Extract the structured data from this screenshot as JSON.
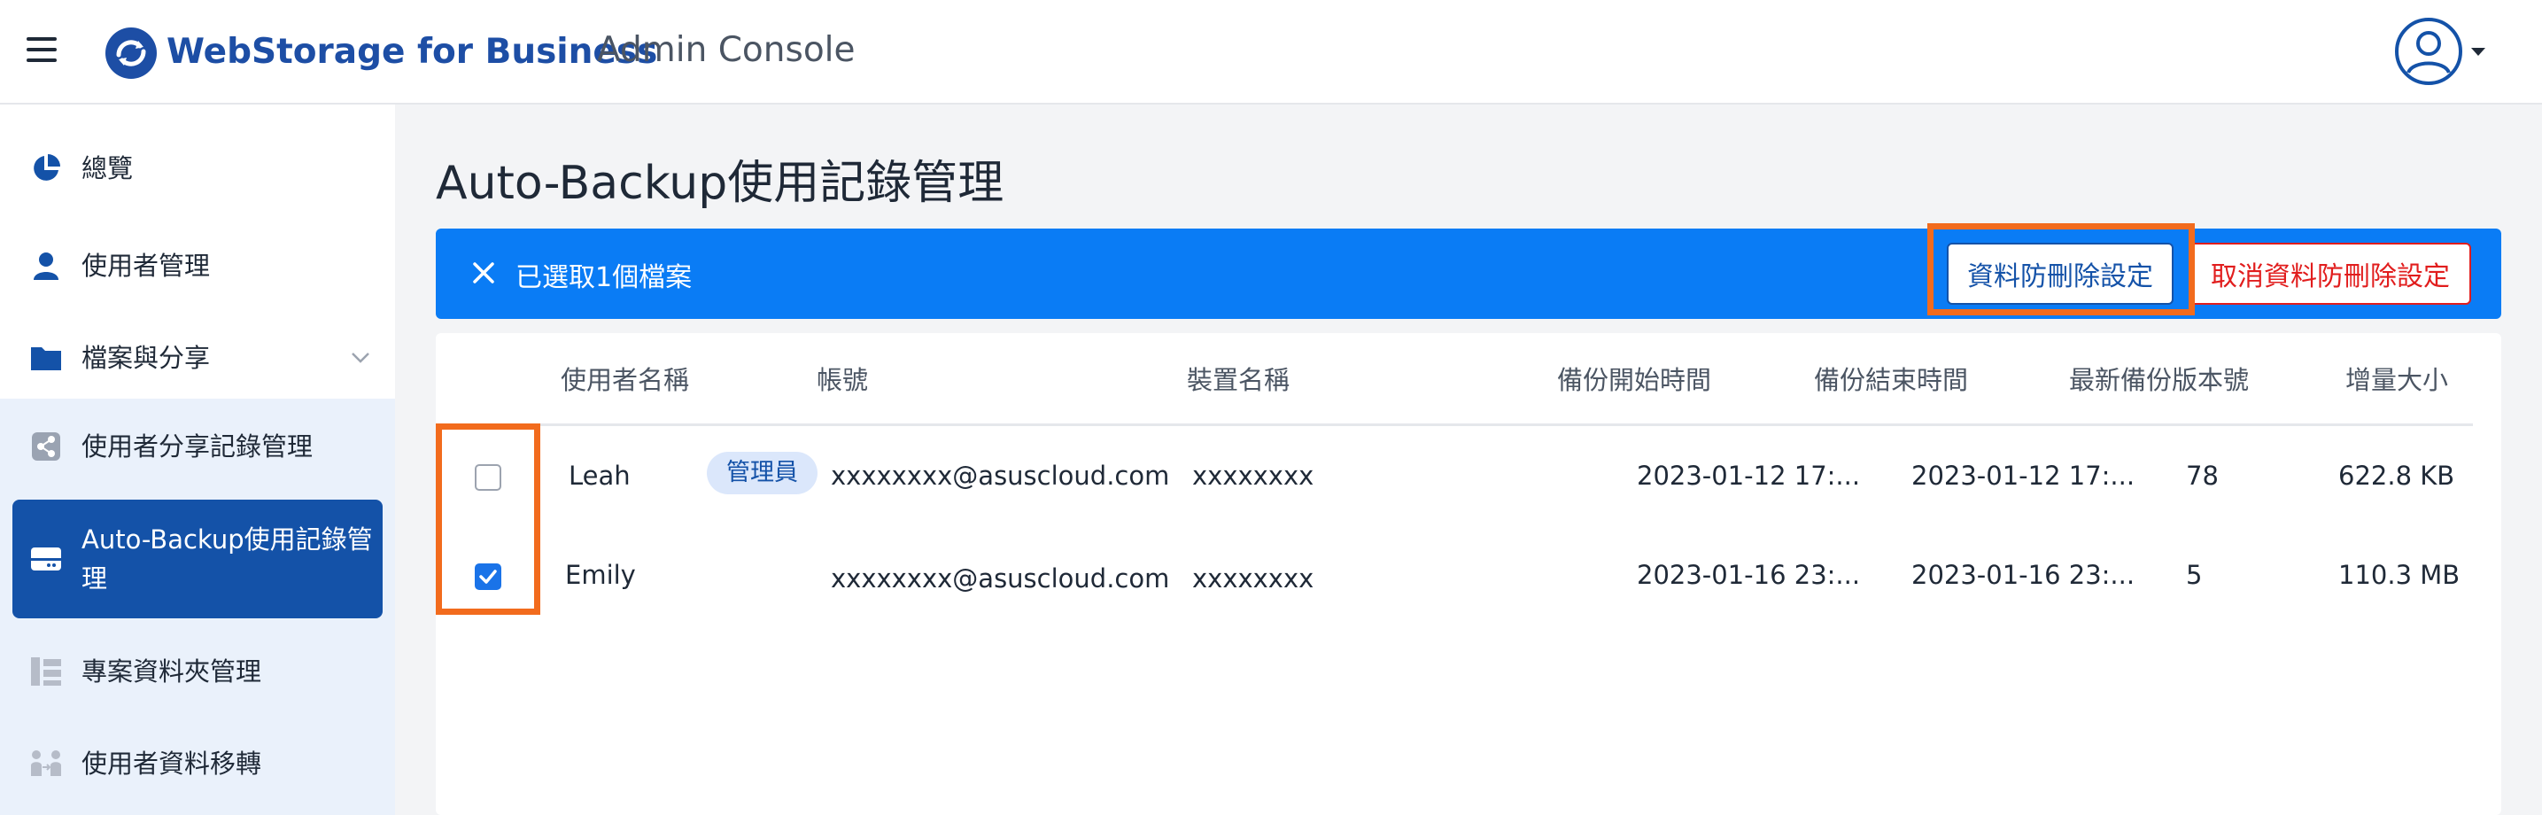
{
  "header": {
    "brand": "WebStorage for Business",
    "subtitle": "Admin Console"
  },
  "sidebar": {
    "items": [
      {
        "label": "總覽",
        "icon": "pie-chart-icon"
      },
      {
        "label": "使用者管理",
        "icon": "user-icon"
      },
      {
        "label": "檔案與分享",
        "icon": "folder-icon"
      },
      {
        "label": "使用者分享記錄管理",
        "icon": "share-icon"
      },
      {
        "label": "Auto-Backup使用記錄管理",
        "icon": "backup-drive-icon"
      },
      {
        "label": "專案資料夾管理",
        "icon": "project-folder-icon"
      },
      {
        "label": "使用者資料移轉",
        "icon": "user-transfer-icon"
      }
    ]
  },
  "main": {
    "title": "Auto-Backup使用記錄管理",
    "selection": {
      "text": "已選取1個檔案",
      "protect_label": "資料防刪除設定",
      "cancel_label": "取消資料防刪除設定"
    },
    "table": {
      "columns": [
        "使用者名稱",
        "帳號",
        "裝置名稱",
        "備份開始時間",
        "備份結束時間",
        "最新備份版本號",
        "增量大小"
      ],
      "rows": [
        {
          "checked": false,
          "name": "Leah",
          "badge": "管理員",
          "account": "xxxxxxxx@asuscloud.com",
          "device": "xxxxxxxx",
          "start": "2023-01-12 17:...",
          "end": "2023-01-12 17:...",
          "version": "78",
          "size": "622.8 KB"
        },
        {
          "checked": true,
          "name": "Emily",
          "badge": "",
          "account": "xxxxxxxx@asuscloud.com",
          "device": "xxxxxxxx",
          "start": "2023-01-16 23:...",
          "end": "2023-01-16 23:...",
          "version": "5",
          "size": "110.3 MB"
        }
      ]
    }
  },
  "colors": {
    "brand": "#1d4ea5",
    "selection_bar": "#0a7cf5",
    "danger": "#e11d1d",
    "highlight": "#f26b1d"
  }
}
